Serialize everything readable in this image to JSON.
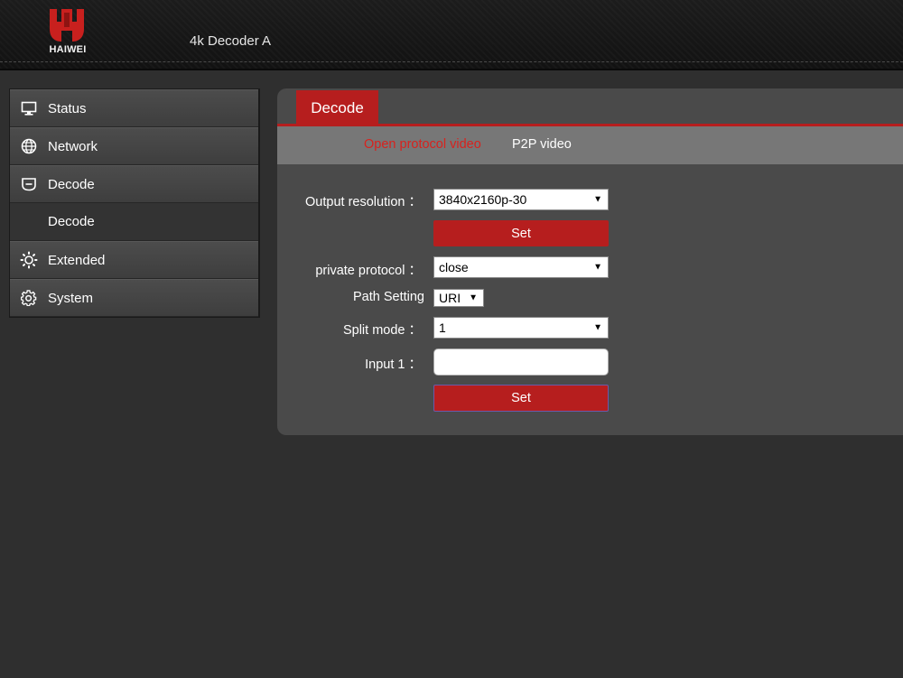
{
  "header": {
    "brand": "HAIWEI",
    "title": "4k Decoder  A",
    "logo_color": "#c8201e"
  },
  "sidebar": {
    "items": [
      {
        "label": "Status",
        "icon": "monitor-icon"
      },
      {
        "label": "Network",
        "icon": "globe-icon"
      },
      {
        "label": "Decode",
        "icon": "decoder-icon"
      },
      {
        "label": "Extended",
        "icon": "sun-gear-icon"
      },
      {
        "label": "System",
        "icon": "gear-icon"
      }
    ],
    "sub_items": [
      {
        "label": "Decode"
      }
    ]
  },
  "main": {
    "tab": "Decode",
    "subtabs": [
      {
        "label": "Open protocol video",
        "active": true
      },
      {
        "label": "P2P video",
        "active": false
      }
    ],
    "form": {
      "output_resolution": {
        "label": "Output resolution ：",
        "value": "3840x2160p-30"
      },
      "set1_label": "Set",
      "private_protocol": {
        "label": "private protocol ：",
        "value": "close"
      },
      "path_setting": {
        "label": "Path Setting",
        "value": "URI"
      },
      "split_mode": {
        "label": "Split mode ：",
        "value": "1"
      },
      "input1": {
        "label": "Input 1 ：",
        "value": ""
      },
      "set2_label": "Set"
    }
  },
  "colors": {
    "accent": "#b61e1e",
    "active_subtab": "#d8221e",
    "background": "#2f2f2f",
    "panel": "#4a4a4a"
  }
}
